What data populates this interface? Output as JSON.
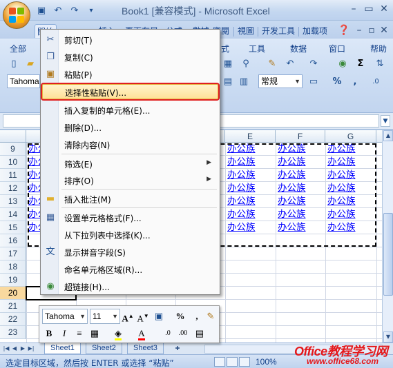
{
  "window": {
    "title": "Book1 [兼容模式] - Microsoft Excel"
  },
  "quick_access": {
    "icons": [
      "save-icon",
      "undo-icon",
      "redo-icon",
      "customize-icon"
    ]
  },
  "ribbon_tabs": [
    "開始",
    "插入",
    "頁面布局",
    "公式",
    "數據",
    "審閱",
    "視圖",
    "开发工具",
    "加载项"
  ],
  "menu_bar": {
    "items": [
      "全部",
      "式",
      "工具",
      "数据",
      "窗口",
      "帮助"
    ]
  },
  "toolbar": {
    "font_name": "Tahoma",
    "number_format": "常规",
    "percent": "%",
    "comma": ","
  },
  "columns": [
    "E",
    "F",
    "G"
  ],
  "rows": [
    "9",
    "10",
    "11",
    "12",
    "13",
    "14",
    "15",
    "16",
    "17",
    "18",
    "19",
    "20",
    "21",
    "22",
    "23"
  ],
  "cell_text": "办公族",
  "partial_cell_text": "办公",
  "context_menu": {
    "items": [
      {
        "label": "剪切(T)",
        "icon": "cut-icon"
      },
      {
        "label": "复制(C)",
        "icon": "copy-icon"
      },
      {
        "label": "粘贴(P)",
        "icon": "paste-icon"
      },
      {
        "label": "选择性粘贴(V)...",
        "icon": ""
      },
      {
        "label": "插入复制的单元格(E)...",
        "icon": ""
      },
      {
        "label": "删除(D)...",
        "icon": ""
      },
      {
        "label": "清除内容(N)",
        "icon": ""
      },
      {
        "label": "筛选(E)",
        "icon": ""
      },
      {
        "label": "排序(O)",
        "icon": ""
      },
      {
        "label": "插入批注(M)",
        "icon": "comment-icon"
      },
      {
        "label": "设置单元格格式(F)...",
        "icon": "format-cells-icon"
      },
      {
        "label": "从下拉列表中选择(K)...",
        "icon": ""
      },
      {
        "label": "显示拼音字段(S)",
        "icon": "phonetic-icon"
      },
      {
        "label": "命名单元格区域(R)...",
        "icon": ""
      },
      {
        "label": "超链接(H)...",
        "icon": "hyperlink-icon"
      }
    ]
  },
  "mini_toolbar": {
    "font_name": "Tahoma",
    "font_size": "11",
    "percent": "%",
    "comma": ",",
    "bold": "B",
    "italic": "I"
  },
  "sheets": [
    "Sheet1",
    "Sheet2",
    "Sheet3"
  ],
  "status": {
    "message": "选定目标区域，然后按 ENTER 或选择 “粘贴”",
    "zoom": "100%"
  },
  "watermark": {
    "line1": "Office教程学习网",
    "line2": "www.office68.com"
  },
  "colors": {
    "highlight_border": "#e02020",
    "link_text": "#0000ff",
    "watermark": "#e4181b"
  }
}
